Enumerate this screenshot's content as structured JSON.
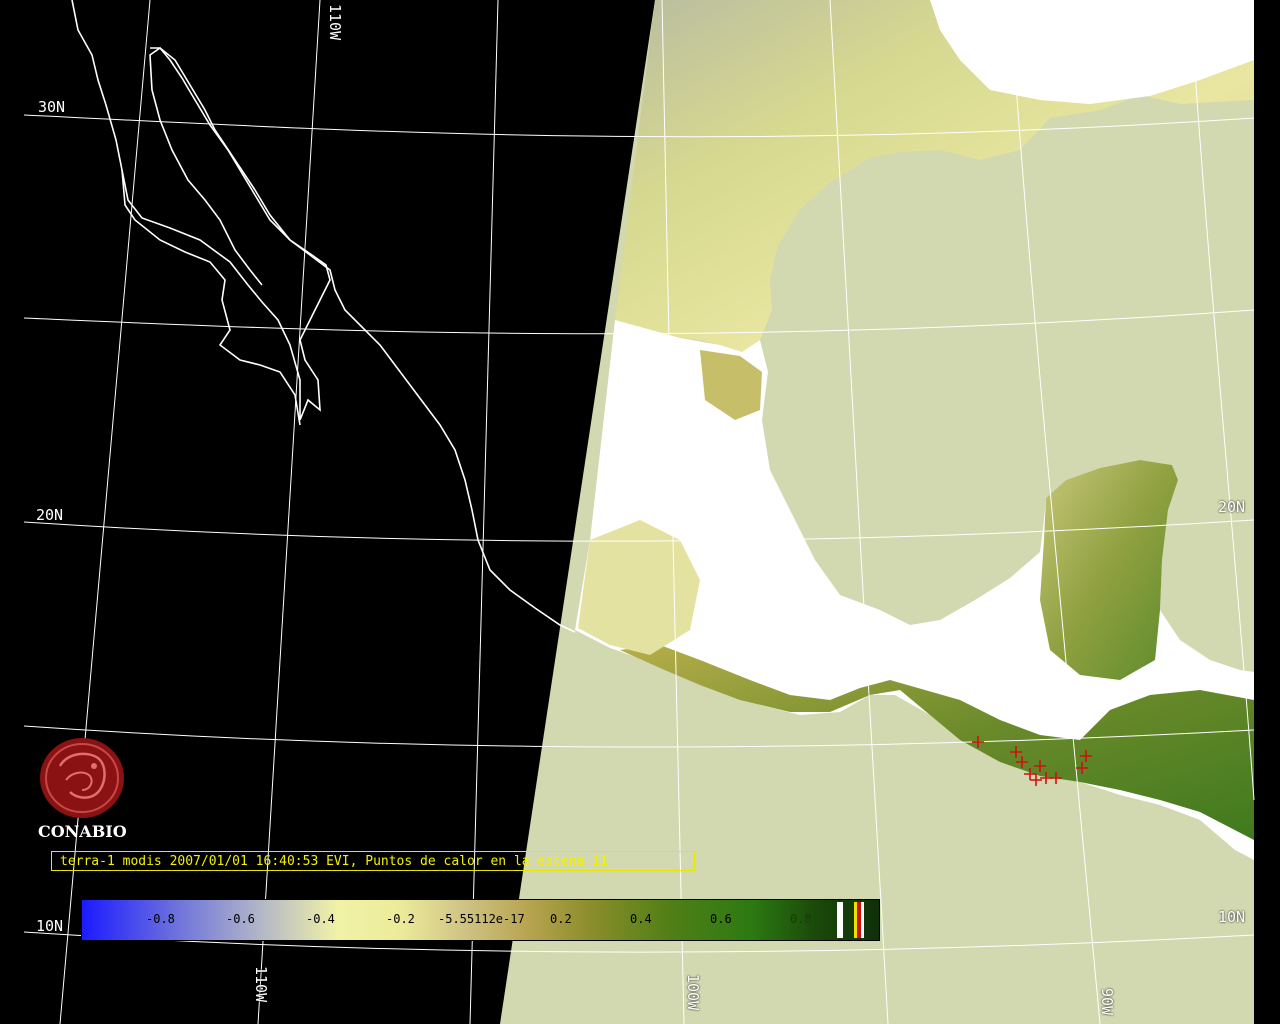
{
  "map": {
    "lat_labels": [
      "30N",
      "20N",
      "10N",
      "20N",
      "10N"
    ],
    "lon_labels": [
      "110W",
      "110W",
      "100W",
      "90W"
    ],
    "colors": {
      "background": "#000000",
      "ocean": "#d2d8b0",
      "cloud": "#ffffff",
      "coast": "#ffffff",
      "grid": "#ffffff",
      "fire_marker": "#d01010"
    }
  },
  "logo": {
    "name": "CONABIO",
    "icon": "conabio-logo-icon"
  },
  "caption": {
    "text": "terra-1 modis 2007/01/01 16:40:53 EVI, Puntos de calor en la escena 11"
  },
  "colorbar": {
    "ticks": [
      "-0.8",
      "-0.6",
      "-0.4",
      "-0.2",
      "-5.55112e-17",
      "0.2",
      "0.4",
      "0.6",
      "0.8"
    ]
  }
}
